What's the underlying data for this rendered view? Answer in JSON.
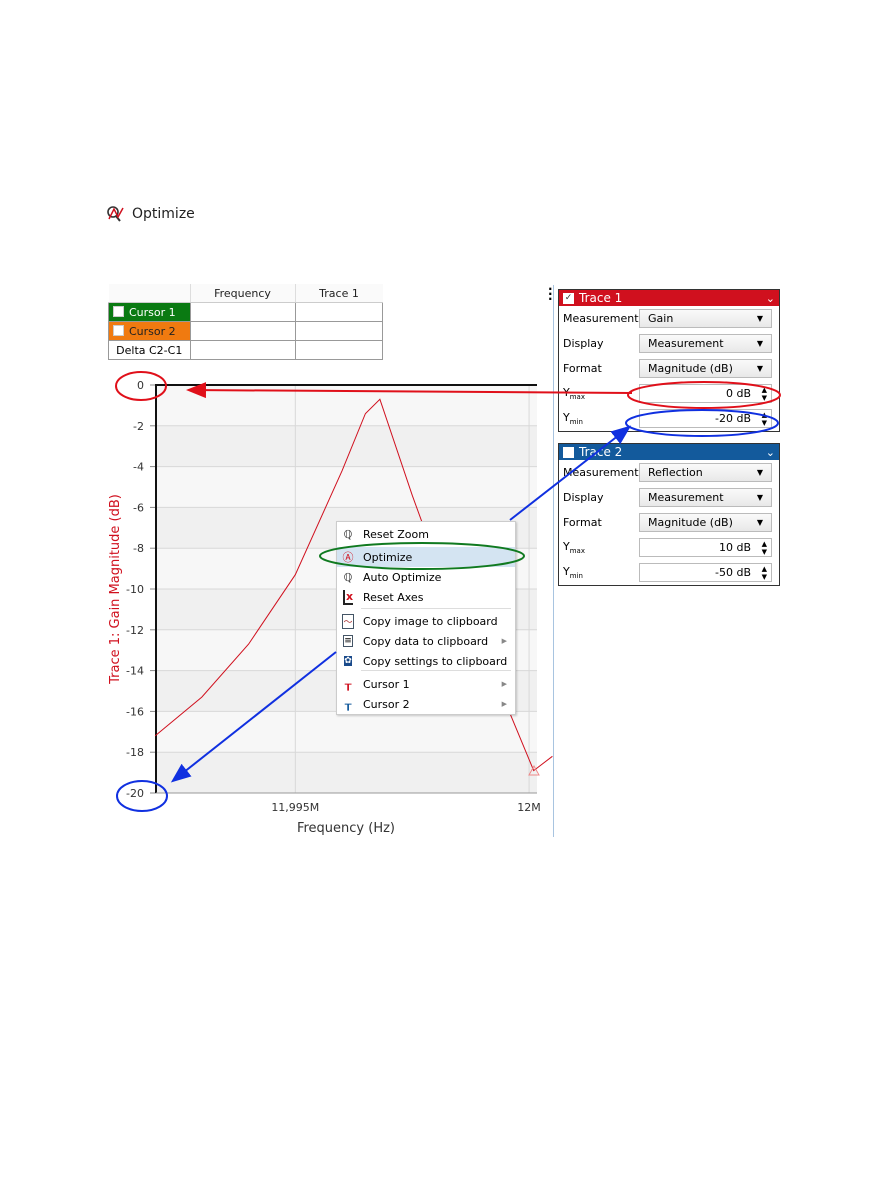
{
  "header": {
    "icon": "optimize-icon",
    "label": "Optimize"
  },
  "cursor_table": {
    "columns": [
      "Frequency",
      "Trace 1"
    ],
    "rows": [
      {
        "label": "Cursor 1",
        "color": "#0a7a12"
      },
      {
        "label": "Cursor 2",
        "color": "#f07a10"
      },
      {
        "label": "Delta C2-C1"
      }
    ]
  },
  "trace1": {
    "title": "Trace 1",
    "checked": true,
    "color": "#d0101e",
    "measurement_label": "Measurement",
    "measurement": "Gain",
    "display_label": "Display",
    "display": "Measurement",
    "format_label": "Format",
    "format": "Magnitude (dB)",
    "ymax_label": "Y",
    "ymax_sub": "max",
    "ymax": "0 dB",
    "ymin_label": "Y",
    "ymin_sub": "min",
    "ymin": "-20 dB"
  },
  "trace2": {
    "title": "Trace 2",
    "checked": false,
    "color": "#135a9c",
    "measurement_label": "Measurement",
    "measurement": "Reflection",
    "display_label": "Display",
    "display": "Measurement",
    "format_label": "Format",
    "format": "Magnitude (dB)",
    "ymax_label": "Y",
    "ymax_sub": "max",
    "ymax": "10 dB",
    "ymin_label": "Y",
    "ymin_sub": "min",
    "ymin": "-50 dB"
  },
  "context_menu": {
    "items": [
      {
        "label": "Reset Zoom",
        "icon": "reset-zoom-icon"
      },
      {
        "label": "Optimize",
        "icon": "optimize-icon",
        "highlighted": true
      },
      {
        "label": "Auto Optimize",
        "icon": "auto-optimize-icon"
      },
      {
        "label": "Reset Axes",
        "icon": "reset-axes-icon"
      },
      {
        "label": "Copy image to clipboard",
        "icon": "copy-image-icon"
      },
      {
        "label": "Copy data to clipboard",
        "icon": "copy-data-icon",
        "submenu": true
      },
      {
        "label": "Copy settings to clipboard",
        "icon": "copy-settings-icon"
      },
      {
        "label": "Cursor 1",
        "icon": "cursor1-icon",
        "submenu": true
      },
      {
        "label": "Cursor 2",
        "icon": "cursor2-icon",
        "submenu": true
      }
    ]
  },
  "chart_data": {
    "type": "line",
    "xlabel": "Frequency (Hz)",
    "ylabel": "Trace 1: Gain Magnitude (dB)",
    "xlim": [
      11.99202,
      12.00017
    ],
    "ylim": [
      -20,
      0
    ],
    "x_unit": "MHz",
    "xticks": [
      {
        "value": 11.995,
        "label": "11,995M"
      },
      {
        "value": 12.0,
        "label": "12M"
      }
    ],
    "yticks": [
      0,
      -2,
      -4,
      -6,
      -8,
      -10,
      -12,
      -14,
      -16,
      -18,
      -20
    ],
    "grid": true,
    "series": [
      {
        "color": "#d0101e",
        "x": [
          11.992,
          11.993,
          11.994,
          11.995,
          11.996,
          11.9965,
          11.99681,
          11.9975,
          11.9985,
          11.9995,
          12.0005,
          12.0001
        ],
        "y": [
          -17.2,
          -15.3,
          -12.7,
          -9.3,
          -4.2,
          -1.4,
          -0.7,
          -5.4,
          -11.7,
          -15.6,
          -18.2,
          -18.9
        ]
      }
    ]
  },
  "annotation_colors": {
    "red": "#e0101a",
    "blue": "#1030e0",
    "green": "#107a20"
  }
}
